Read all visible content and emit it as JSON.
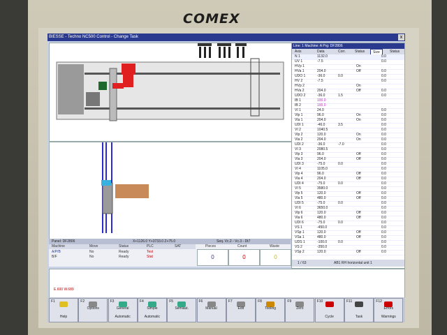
{
  "monitor": {
    "brand": "COMEX"
  },
  "window": {
    "title": "BIESSE - Techno NC500 Control - Change Task",
    "close": "x"
  },
  "panel": {
    "label": "Panel: DF2806",
    "coords": "X+1126.0 Y+3733.0 Z+75.0",
    "seq": "Seq. Vc.2 - Vc.3 - Dt7"
  },
  "machine_table": {
    "headers": [
      "Machine",
      "Move",
      "Status",
      "PLC",
      "SAT"
    ],
    "rows": [
      [
        "A/P/B",
        "No",
        "Ready",
        "Test"
      ],
      [
        "B/F",
        "No",
        "Ready",
        "Stat"
      ]
    ]
  },
  "counters": [
    {
      "label": "Pieces",
      "value": "0"
    },
    {
      "label": "Count",
      "value": "0"
    },
    {
      "label": "Waste",
      "value": "0"
    }
  ],
  "axis_panel": {
    "header": "Line: 1  Machine: A  Prg: DF2806",
    "columns": [
      "Axis",
      "Data",
      "Corr.",
      "Status",
      "Size",
      "Status"
    ],
    "rows": [
      [
        "N 1",
        "1132.0",
        "",
        "",
        "0.0"
      ],
      [
        "UV 1",
        "-7.5",
        "",
        "",
        "0.0"
      ],
      [
        "HVp 1",
        "",
        "",
        "On",
        ""
      ],
      [
        "HVa 1",
        "204.0",
        "",
        "Off",
        "0.0"
      ],
      [
        "UDO 1",
        "-36.0",
        "0.0",
        "",
        "0.0"
      ],
      [
        "HV 2",
        "-7.5",
        "",
        "",
        "0.0"
      ],
      [
        "HVp 2",
        "",
        "",
        "On",
        ""
      ],
      [
        "HVa 2",
        "204.0",
        "",
        "Off",
        "0.0"
      ],
      [
        "UDO 2",
        "-36.0",
        "1.5",
        "",
        "0.0"
      ],
      [
        "IB 1",
        "100.0",
        "",
        "",
        ""
      ],
      [
        "IB 2",
        "100.0",
        "",
        "",
        ""
      ],
      [
        "VI 1",
        "24.0",
        "",
        "",
        "0.0"
      ],
      [
        "Vlp 1",
        "96.0",
        "",
        "On",
        "0.0"
      ],
      [
        "Vla 1",
        "204.0",
        "",
        "On",
        "0.0"
      ],
      [
        "UDI 1",
        "-46.0",
        "3.5",
        "",
        "0.0"
      ],
      [
        "VI 2",
        "1040.5",
        "",
        "",
        "0.0"
      ],
      [
        "Vlp 2",
        "120.0",
        "",
        "On",
        "0.0"
      ],
      [
        "Vla 2",
        "204.0",
        "",
        "On",
        "0.0"
      ],
      [
        "UDI 2",
        "-36.0",
        "-7.0",
        "",
        "0.0"
      ],
      [
        "VI 3",
        "2080.5",
        "",
        "",
        "0.0"
      ],
      [
        "Vlp 3",
        "96.0",
        "",
        "Off",
        "0.0"
      ],
      [
        "Vla 3",
        "204.0",
        "",
        "Off",
        "0.0"
      ],
      [
        "UDI 3",
        "-75.0",
        "0.0",
        "",
        "0.0"
      ],
      [
        "VI 4",
        "1105.0",
        "",
        "",
        "0.0"
      ],
      [
        "Vlp 4",
        "96.0",
        "",
        "Off",
        "0.0"
      ],
      [
        "Vla 4",
        "204.0",
        "",
        "Off",
        "0.0"
      ],
      [
        "UDI 4",
        "-75.0",
        "0.0",
        "",
        "0.0"
      ],
      [
        "VI 5",
        "3580.0",
        "",
        "",
        "0.0"
      ],
      [
        "Vlp 5",
        "120.0",
        "",
        "Off",
        "0.0"
      ],
      [
        "Vla 5",
        "480.0",
        "",
        "Off",
        "0.0"
      ],
      [
        "UDI 5",
        "-75.0",
        "0.0",
        "",
        "0.0"
      ],
      [
        "VI 6",
        "3650.0",
        "",
        "",
        "0.0"
      ],
      [
        "Vlp 6",
        "120.0",
        "",
        "Off",
        "0.0"
      ],
      [
        "Vla 6",
        "480.0",
        "",
        "Off",
        "0.0"
      ],
      [
        "UDI 6",
        "-75.0",
        "0.0",
        "",
        "0.0"
      ],
      [
        "VS 1",
        "-450.0",
        "",
        "",
        "0.0"
      ],
      [
        "VSp 1",
        "120.0",
        "",
        "Off",
        "0.0"
      ],
      [
        "VSa 1",
        "480.0",
        "",
        "Off",
        "0.0"
      ],
      [
        "UDS 1",
        "-100.0",
        "0.0",
        "",
        "0.0"
      ],
      [
        "VS 2",
        "-350.0",
        "",
        "",
        "0.0"
      ],
      [
        "VSp 2",
        "120.0",
        "",
        "Off",
        "0.0"
      ]
    ],
    "footer_page": "1 / 63",
    "footer_text": "AB1 RH horizontal unit 1"
  },
  "message": "E.600  W.689",
  "fkeys": [
    {
      "key": "F1",
      "l1": "",
      "l2": "Help"
    },
    {
      "key": "F2",
      "l1": "Options",
      "l2": ""
    },
    {
      "key": "F3",
      "l1": "General",
      "l2": "Automatic"
    },
    {
      "key": "F4",
      "l1": "Simple",
      "l2": "Automatic"
    },
    {
      "key": "F5",
      "l1": "Semiaut.",
      "l2": ""
    },
    {
      "key": "F6",
      "l1": "Manual",
      "l2": ""
    },
    {
      "key": "F7",
      "l1": "Edit",
      "l2": ""
    },
    {
      "key": "F8",
      "l1": "Tooling",
      "l2": ""
    },
    {
      "key": "F9",
      "l1": "Zero",
      "l2": ""
    },
    {
      "key": "F10",
      "l1": "",
      "l2": "Cycle"
    },
    {
      "key": "F11",
      "l1": "",
      "l2": "Task"
    },
    {
      "key": "F12",
      "l1": "Errors",
      "l2": "Warnings"
    }
  ],
  "colors": {
    "titlebar": "#2a3b8f",
    "error": "#c00000",
    "tool_red": "#e02020"
  }
}
